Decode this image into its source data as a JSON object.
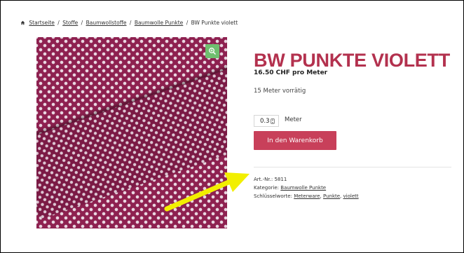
{
  "breadcrumb": {
    "home": "Startseite",
    "items": [
      "Stoffe",
      "Baumwollstoffe",
      "Baumwolle Punkte"
    ],
    "current": "BW Punkte violett",
    "separator": "/"
  },
  "product": {
    "title": "BW PUNKTE VIOLETT",
    "price": "16.50 CHF pro Meter",
    "stock": "15 Meter vorrätig",
    "quantity": "0.3",
    "unit": "Meter",
    "add_to_cart": "In den Warenkorb"
  },
  "meta": {
    "sku_label": "Art.-Nr.:",
    "sku_value": "5811",
    "category_label": "Kategorie:",
    "category_value": "Baumwolle Punkte",
    "tags_label": "Schlüsselworte:",
    "tags": [
      "Meterware",
      "Punkte",
      "violett"
    ]
  },
  "icons": {
    "home": "home-icon",
    "zoom": "zoom-in-icon",
    "annotation": "arrow-icon"
  },
  "colors": {
    "accent": "#c8405a",
    "title": "#b3314e",
    "fabric": "#8e2150",
    "zoom": "#6fbf6f",
    "arrow": "#f2ef00"
  }
}
